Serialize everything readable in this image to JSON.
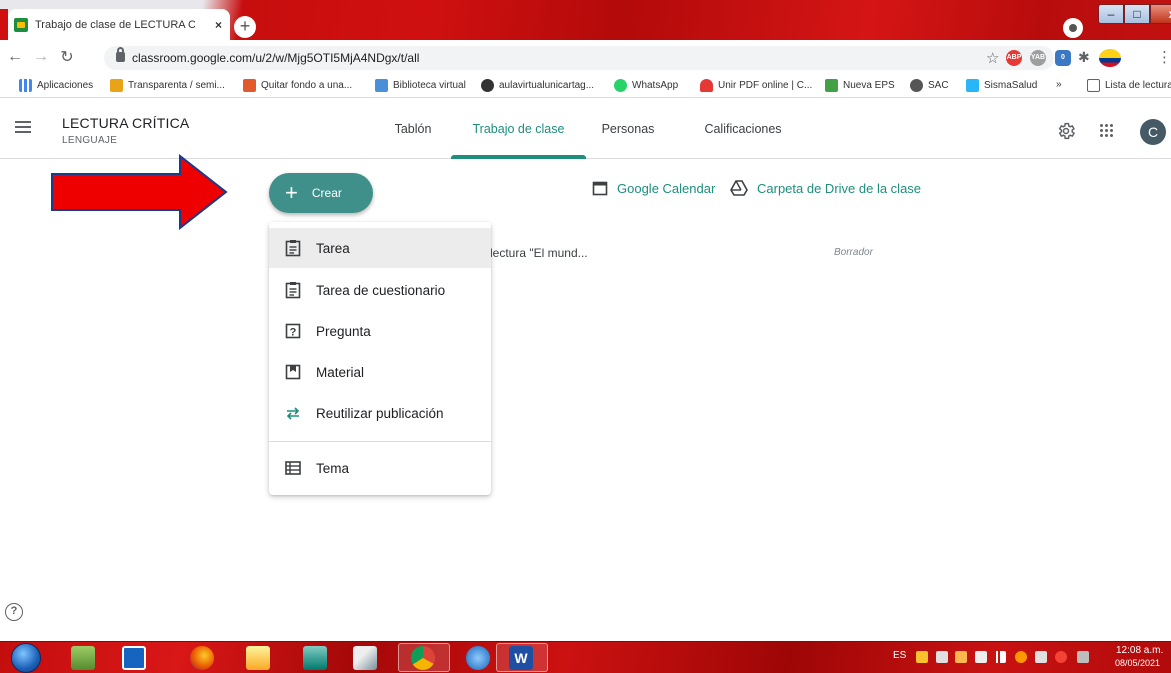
{
  "browser": {
    "tab_title": "Trabajo de clase de LECTURA CRÍ",
    "tab_close": "×",
    "new_tab": "+",
    "url": "classroom.google.com/u/2/w/Mjg5OTI5MjA4NDgx/t/all",
    "window_controls": {
      "minimize": "–",
      "maximize": "□",
      "close": "x"
    }
  },
  "bookmarks": [
    {
      "label": "Aplicaciones",
      "color": "#4285f4"
    },
    {
      "label": "Transparenta / semi...",
      "color": "#e8a317"
    },
    {
      "label": "Quitar fondo a una...",
      "color": "#e25a2b"
    },
    {
      "label": "Biblioteca virtual",
      "color": "#4a90d9"
    },
    {
      "label": "aulavirtualunicartag...",
      "color": "#333333"
    },
    {
      "label": "WhatsApp",
      "color": "#25d366"
    },
    {
      "label": "Unir PDF online | C...",
      "color": "#e53935"
    },
    {
      "label": "Nueva EPS",
      "color": "#43a047"
    },
    {
      "label": "SAC",
      "color": "#555555"
    },
    {
      "label": "SismaSalud",
      "color": "#29b6f6"
    }
  ],
  "bookmarks_more": "»",
  "reading_list": "Lista de lectura",
  "extensions": {
    "abp": "ABP",
    "yab": "YAB",
    "badge_count": "0"
  },
  "classroom": {
    "class_name": "LECTURA CRÍTICA",
    "section": "LENGUAJE",
    "tabs": [
      {
        "label": "Tablón",
        "active": false
      },
      {
        "label": "Trabajo de clase",
        "active": true
      },
      {
        "label": "Personas",
        "active": false
      },
      {
        "label": "Calificaciones",
        "active": false
      }
    ],
    "avatar_letter": "C",
    "accent_color": "#1e8e7e"
  },
  "main": {
    "create_button": "Crear",
    "calendar_link": "Google Calendar",
    "drive_link": "Carpeta de Drive de la clase",
    "draft_item": {
      "title_fragment": "lectura \"El mund...",
      "status": "Borrador"
    },
    "help": "?"
  },
  "create_menu": [
    {
      "label": "Tarea",
      "icon": "assignment-icon",
      "highlighted": true
    },
    {
      "label": "Tarea de cuestionario",
      "icon": "quiz-assignment-icon",
      "highlighted": false
    },
    {
      "label": "Pregunta",
      "icon": "question-icon",
      "highlighted": false
    },
    {
      "label": "Material",
      "icon": "material-icon",
      "highlighted": false
    },
    {
      "label": "Reutilizar publicación",
      "icon": "reuse-icon",
      "highlighted": false
    },
    {
      "label": "Tema",
      "icon": "topic-icon",
      "highlighted": false
    }
  ],
  "taskbar": {
    "language": "ES",
    "time": "12:08 a.m.",
    "date": "08/05/2021"
  }
}
